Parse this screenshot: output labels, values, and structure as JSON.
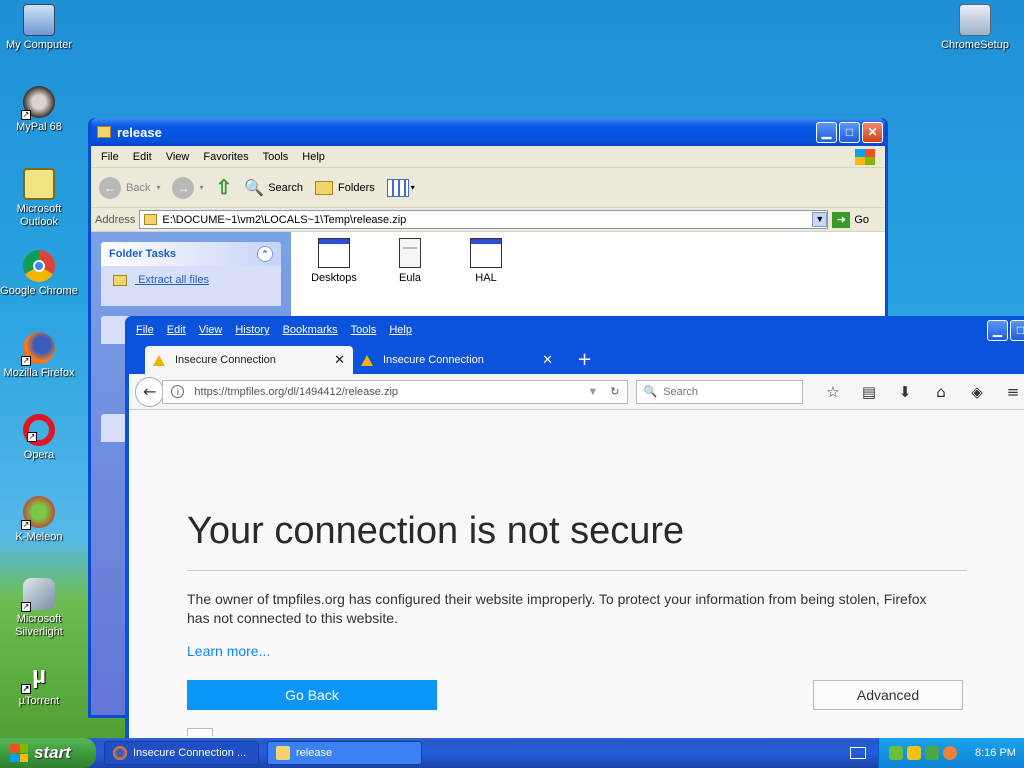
{
  "desktop": {
    "icons": [
      {
        "label": "My Computer"
      },
      {
        "label": "MyPal 68"
      },
      {
        "label": "Microsoft Outlook"
      },
      {
        "label": "Google Chrome"
      },
      {
        "label": "Mozilla Firefox"
      },
      {
        "label": "Opera"
      },
      {
        "label": "K-Meleon"
      },
      {
        "label": "Microsoft Silverlight"
      },
      {
        "label": "µTorrent"
      },
      {
        "label": "ChromeSetup"
      }
    ]
  },
  "explorer": {
    "title": "release",
    "menu": [
      "File",
      "Edit",
      "View",
      "Favorites",
      "Tools",
      "Help"
    ],
    "toolbar": {
      "back": "Back",
      "search": "Search",
      "folders": "Folders"
    },
    "address_label": "Address",
    "address_value": "E:\\DOCUME~1\\vm2\\LOCALS~1\\Temp\\release.zip",
    "go_label": "Go",
    "folder_tasks_title": "Folder Tasks",
    "extract_link": "Extract all files",
    "files": [
      {
        "name": "Desktops"
      },
      {
        "name": "Eula"
      },
      {
        "name": "HAL"
      }
    ]
  },
  "firefox": {
    "menu": [
      "File",
      "Edit",
      "View",
      "History",
      "Bookmarks",
      "Tools",
      "Help"
    ],
    "tabs": [
      {
        "title": "Insecure Connection",
        "close": "✕"
      },
      {
        "title": "Insecure Connection",
        "close": "✕"
      }
    ],
    "new_tab": "+",
    "url": "https://tmpfiles.org/dl/1494412/release.zip",
    "search_placeholder": "Search",
    "error": {
      "title": "Your connection is not secure",
      "description": "The owner of tmpfiles.org has configured their website improperly. To protect your information from being stolen, Firefox has not connected to this website.",
      "learn_more": "Learn more...",
      "go_back": "Go Back",
      "advanced": "Advanced"
    }
  },
  "taskbar": {
    "start_label": "start",
    "tasks": [
      {
        "label": "Insecure Connection ..."
      },
      {
        "label": "release"
      }
    ],
    "clock": "8:16 PM"
  }
}
